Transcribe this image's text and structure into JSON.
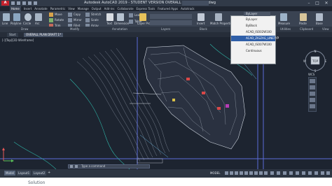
{
  "window": {
    "title": "Autodesk AutoCAD 2019 - STUDENT VERSION   OVERALL PLAN DRAFT 1.dwg",
    "logo": "A",
    "minimize": "–",
    "maximize": "□",
    "close": "✕"
  },
  "ribbon_tabs": [
    "Home",
    "Insert",
    "Annotate",
    "Parametric",
    "View",
    "Manage",
    "Output",
    "Add-ins",
    "Collaborate",
    "Express Tools",
    "Featured Apps",
    "Autotrack"
  ],
  "ribbon": {
    "draw_tools": [
      "Line",
      "Polyline",
      "Circle",
      "Arc"
    ],
    "modify_tools": [
      "Move",
      "Rotate",
      "Trim",
      "Copy",
      "Mirror",
      "Fillet",
      "Stretch",
      "Scale",
      "Array"
    ],
    "annotation_tools": [
      "Text",
      "Dimension",
      "Leader",
      "Table"
    ],
    "layer_tools": [
      "Layer Properties",
      "Match Layer"
    ],
    "block_tools": [
      "Insert"
    ],
    "properties_tools": [
      "Match Properties"
    ],
    "right_tools": [
      "Measure",
      "Paste",
      "Base"
    ]
  },
  "panel_labels": [
    "Draw",
    "Modify",
    "Annotation",
    "Layers",
    "Block",
    "Utilities",
    "Clipboard",
    "View"
  ],
  "file_tabs": [
    "Start",
    "OVERALL PLAN DRAFT 1*"
  ],
  "viewport_label": "[-][Top][2D Wireframe]",
  "dropdown": {
    "header_item": "ByLayer",
    "items": [
      "ByLayer",
      "ByBlock",
      "ACAD_ISO02W100",
      "ACAD_ZIGZAG_LINETYP",
      "ACAD_ISO07W100",
      "Continuous"
    ],
    "selected_index": 3
  },
  "command_placeholder": "Type a command",
  "layout_tabs": [
    "Model",
    "Layout1",
    "Layout2"
  ],
  "status": {
    "model": "MODEL"
  },
  "navcube": {
    "top": "N",
    "face": "TOP",
    "bottom": "S",
    "left": "W",
    "right": "E",
    "wcs": "WCS"
  },
  "caption": "Solution",
  "colors": {
    "accent": "#2f5fa8",
    "app_logo": "#c3222d",
    "drawing_background": "#1d2430"
  },
  "icons": [
    "app-logo-icon",
    "save-icon",
    "undo-icon",
    "redo-icon",
    "search-icon",
    "line-icon",
    "polyline-icon",
    "circle-icon",
    "arc-icon",
    "move-icon",
    "rotate-icon",
    "trim-icon",
    "text-icon",
    "dimension-icon",
    "layer-icon",
    "insert-icon",
    "measure-icon",
    "paste-icon",
    "ucs-icon",
    "navcube-icon",
    "pan-icon",
    "zoom-icon",
    "orbit-icon"
  ]
}
